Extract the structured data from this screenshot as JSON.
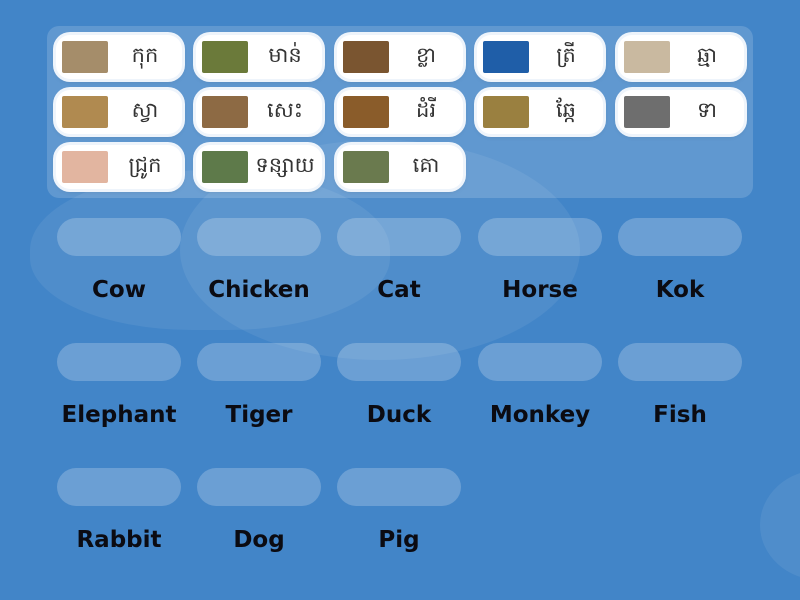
{
  "tray": {
    "cards": [
      {
        "word": "កុក",
        "image": "heron-photo",
        "color": "#a58d6a"
      },
      {
        "word": "មាន់",
        "image": "chicken-photo",
        "color": "#6b7a3a"
      },
      {
        "word": "ខ្លា",
        "image": "tiger-photo",
        "color": "#7a5530"
      },
      {
        "word": "ត្រី",
        "image": "fish-photo",
        "color": "#1f5ea8"
      },
      {
        "word": "ឆ្មា",
        "image": "cat-photo",
        "color": "#c9b9a0"
      },
      {
        "word": "ស្វា",
        "image": "monkey-photo",
        "color": "#b08a50"
      },
      {
        "word": "សេះ",
        "image": "horse-photo",
        "color": "#8d6a44"
      },
      {
        "word": "ដំរី",
        "image": "elephant-photo",
        "color": "#8a5c2a"
      },
      {
        "word": "ឆ្កែ",
        "image": "dog-photo",
        "color": "#9a8040"
      },
      {
        "word": "ទា",
        "image": "duck-photo",
        "color": "#6e6e6e"
      },
      {
        "word": "ជ្រូក",
        "image": "pig-photo",
        "color": "#e2b5a0"
      },
      {
        "word": "ទន្សាយ",
        "image": "rabbit-photo",
        "color": "#5e7a4a"
      },
      {
        "word": "គោ",
        "image": "cow-photo",
        "color": "#6a7a4e"
      }
    ]
  },
  "targets": [
    {
      "label": "Cow"
    },
    {
      "label": "Chicken"
    },
    {
      "label": "Cat"
    },
    {
      "label": "Horse"
    },
    {
      "label": "Kok"
    },
    {
      "label": "Elephant"
    },
    {
      "label": "Tiger"
    },
    {
      "label": "Duck"
    },
    {
      "label": "Monkey"
    },
    {
      "label": "Fish"
    },
    {
      "label": "Rabbit"
    },
    {
      "label": "Dog"
    },
    {
      "label": "Pig"
    }
  ]
}
